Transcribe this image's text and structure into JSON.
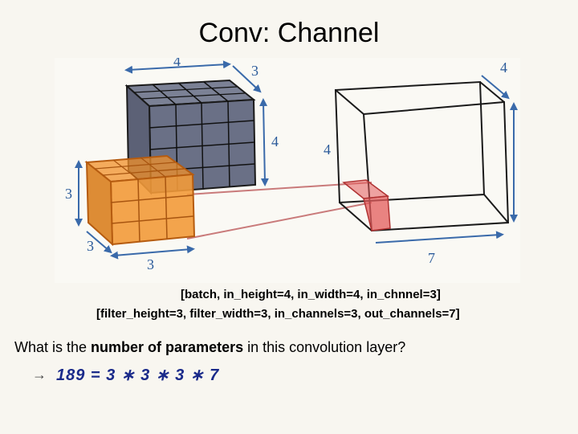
{
  "title": "Conv: Channel",
  "caption1": "[batch, in_height=4, in_width=4, in_chnnel=3]",
  "caption2": "[filter_height=3, filter_width=3, in_channels=3, out_channels=7]",
  "question_pre": "What is the ",
  "question_bold": "number of parameters",
  "question_post": " in this convolution layer?",
  "arrow": "→",
  "equation": "189 =  3 ∗ 3 ∗ 3 ∗ 7",
  "labels": {
    "in_depth_top": "3",
    "in_height": "4",
    "in_width": "4",
    "filter_h": "3",
    "filter_w": "3",
    "filter_d": "3",
    "out_depth_top": "4",
    "out_height": "4",
    "out_width": "7"
  },
  "chart_data": {
    "type": "diagram",
    "title": "Convolution channel illustration",
    "input_tensor": {
      "batch": null,
      "in_height": 4,
      "in_width": 4,
      "in_channels": 3
    },
    "filter": {
      "filter_height": 3,
      "filter_width": 3,
      "in_channels": 3,
      "out_channels": 7
    },
    "output_tensor": {
      "height": 4,
      "width": 4,
      "depth": 7
    },
    "num_parameters": 189,
    "param_formula": "3*3*3*7"
  }
}
